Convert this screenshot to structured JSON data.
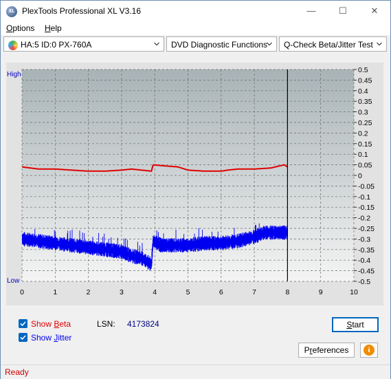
{
  "window": {
    "icon_text": "XL",
    "title": "PlexTools Professional XL V3.16",
    "minimize_glyph": "—",
    "maximize_glyph": "☐",
    "close_glyph": "✕"
  },
  "menu": {
    "options": {
      "accel": "O",
      "rest": "ptions"
    },
    "help": {
      "accel": "H",
      "rest": "elp"
    }
  },
  "toolbar": {
    "drive": "HA:5 ID:0  PX-760A",
    "function": "DVD Diagnostic Functions",
    "test": "Q-Check Beta/Jitter Test"
  },
  "chart": {
    "left_top_label": "High",
    "left_bottom_label": "Low"
  },
  "colors": {
    "beta": "#e00000",
    "jitter": "#0000f0",
    "plot_bg_top": "#a8b3b6",
    "plot_bg_bottom": "#f4f4f4",
    "axis_text": "#000000",
    "high_low_text": "#0000c0"
  },
  "chart_data": {
    "type": "line",
    "x_ticks": [
      "0",
      "1",
      "2",
      "3",
      "4",
      "5",
      "6",
      "7",
      "8",
      "9",
      "10"
    ],
    "y_right_ticks": [
      "0.5",
      "0.45",
      "0.4",
      "0.35",
      "0.3",
      "0.25",
      "0.2",
      "0.15",
      "0.1",
      "0.05",
      "0",
      "-0.05",
      "-0.1",
      "-0.15",
      "-0.2",
      "-0.25",
      "-0.3",
      "-0.35",
      "-0.4",
      "-0.45",
      "-0.5"
    ],
    "xlim": [
      0,
      10
    ],
    "ylim": [
      -0.5,
      0.5
    ],
    "grid": true,
    "end_marker_x": 8.0,
    "series": [
      {
        "key": "beta",
        "x": [
          0,
          0.5,
          1.0,
          1.5,
          2.0,
          2.1,
          2.5,
          3.0,
          3.3,
          3.6,
          3.9,
          3.95,
          4.3,
          4.7,
          5.0,
          5.5,
          6.0,
          6.2,
          6.5,
          7.0,
          7.5,
          7.9,
          8.0
        ],
        "y": [
          0.04,
          0.03,
          0.03,
          0.025,
          0.02,
          0.02,
          0.02,
          0.025,
          0.03,
          0.025,
          0.02,
          0.05,
          0.045,
          0.04,
          0.025,
          0.02,
          0.02,
          0.025,
          0.03,
          0.03,
          0.035,
          0.05,
          0.04
        ]
      },
      {
        "key": "jitter",
        "x": [
          0,
          0.5,
          1.0,
          1.5,
          2.0,
          2.5,
          3.0,
          3.3,
          3.6,
          3.9,
          3.95,
          4.2,
          4.5,
          5.0,
          5.5,
          6.0,
          6.5,
          7.0,
          7.3,
          7.6,
          8.0
        ],
        "y": [
          -0.3,
          -0.31,
          -0.32,
          -0.33,
          -0.34,
          -0.35,
          -0.36,
          -0.38,
          -0.39,
          -0.42,
          -0.31,
          -0.33,
          -0.33,
          -0.33,
          -0.32,
          -0.32,
          -0.31,
          -0.29,
          -0.27,
          -0.27,
          -0.27
        ],
        "noise_amplitude": 0.025
      }
    ]
  },
  "options": {
    "show_beta": {
      "prefix": "Show ",
      "accel": "B",
      "rest": "eta",
      "checked": true
    },
    "show_jitter": {
      "prefix": "Show ",
      "accel": "J",
      "rest": "itter",
      "checked": true
    },
    "lsn_label": "LSN:",
    "lsn_value": "4173824"
  },
  "buttons": {
    "start": {
      "accel": "S",
      "rest": "tart"
    },
    "preferences": {
      "prefix": "P",
      "accel": "r",
      "rest": "eferences"
    },
    "info_glyph": "i"
  },
  "status": {
    "text": "Ready"
  }
}
